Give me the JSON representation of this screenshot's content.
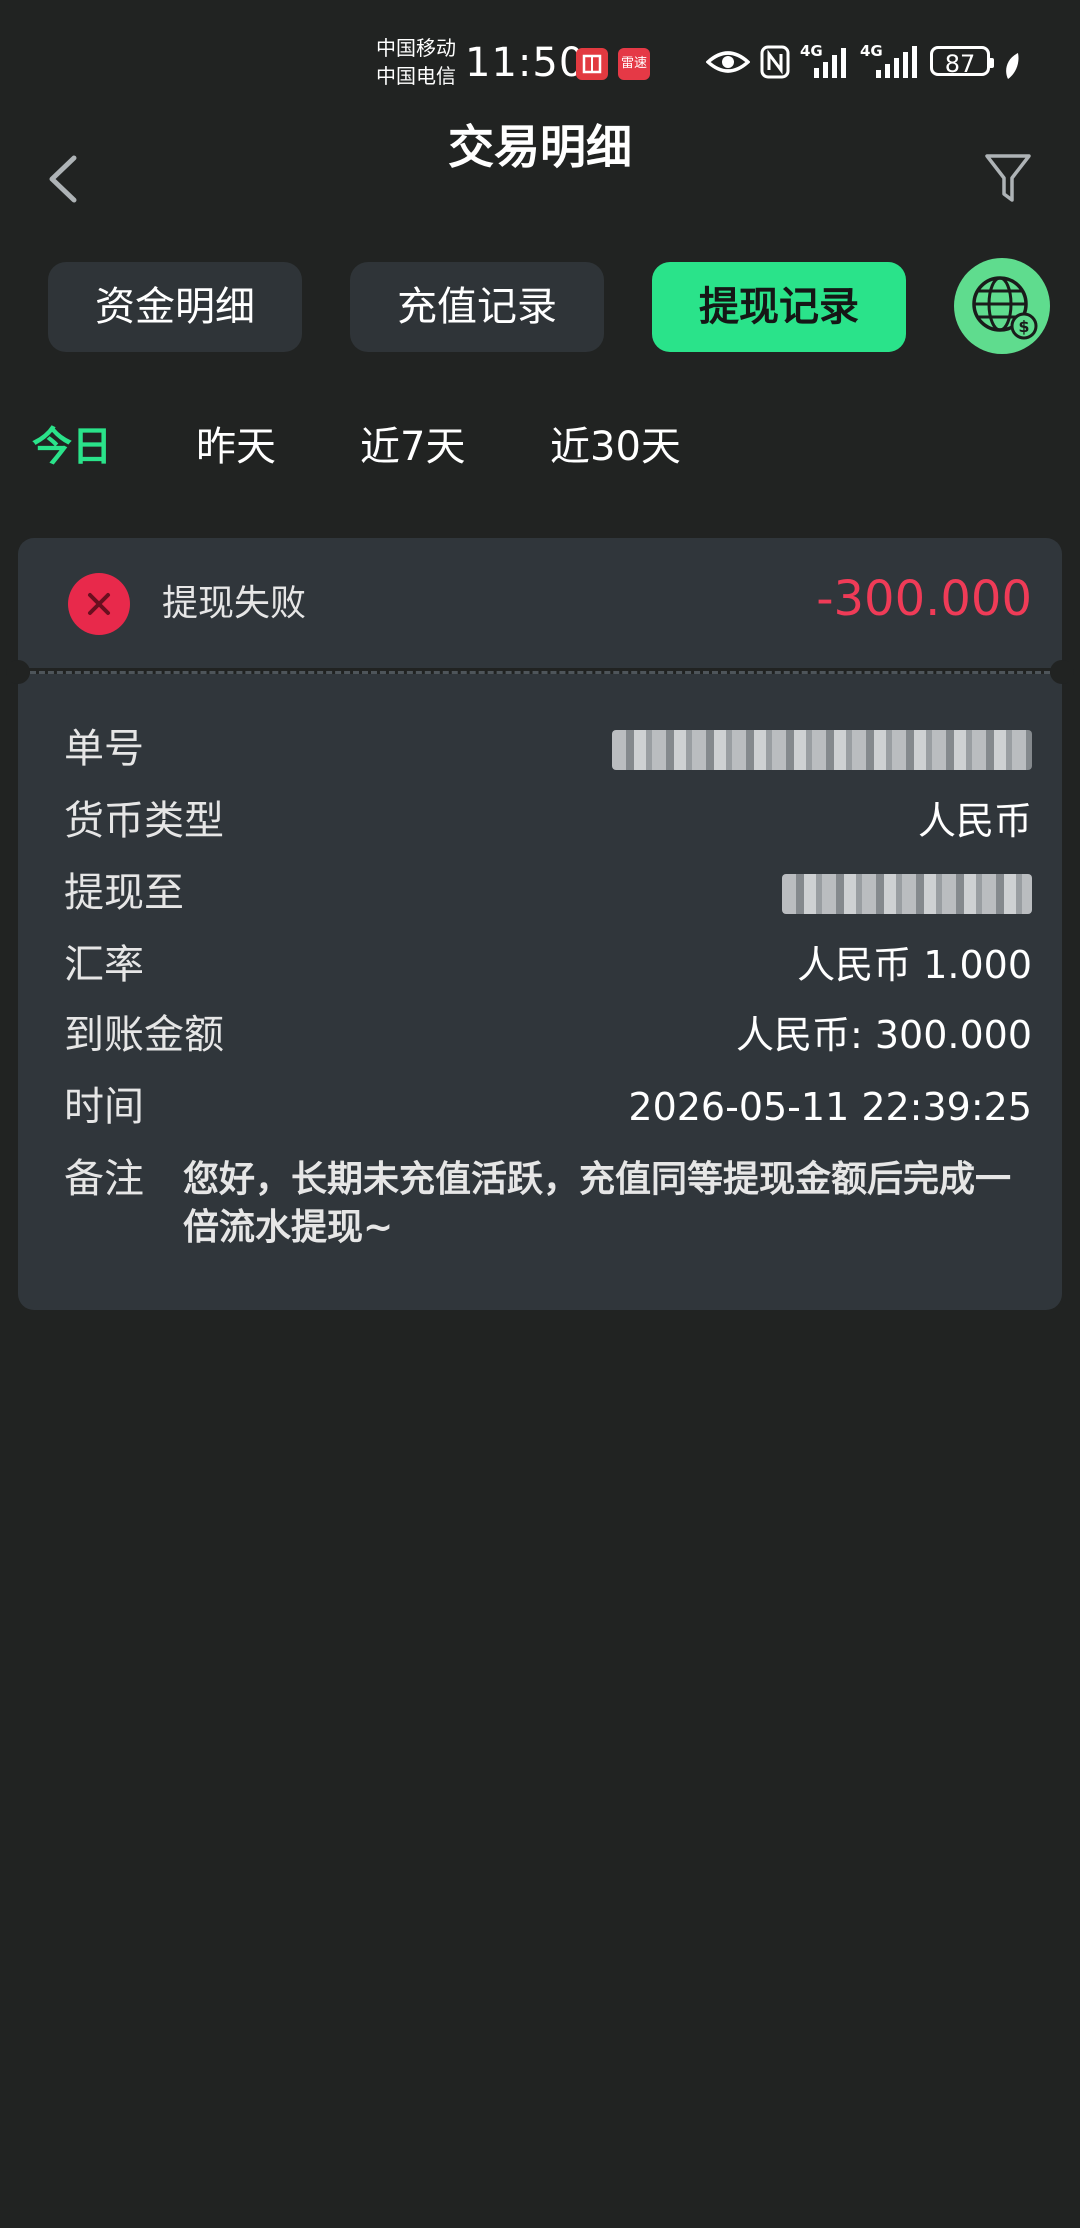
{
  "status_bar": {
    "carrier_1": "中国移动",
    "carrier_2": "中国电信",
    "time": "11:50",
    "network_1": "4G",
    "network_2": "4G",
    "battery": "87",
    "app_icon_2_text": "雷速"
  },
  "header": {
    "title": "交易明细"
  },
  "tabs": [
    {
      "label": "资金明细",
      "active": false
    },
    {
      "label": "充值记录",
      "active": false
    },
    {
      "label": "提现记录",
      "active": true
    }
  ],
  "date_filters": [
    {
      "label": "今日",
      "active": true
    },
    {
      "label": "昨天",
      "active": false
    },
    {
      "label": "近7天",
      "active": false
    },
    {
      "label": "近30天",
      "active": false
    }
  ],
  "record": {
    "status": "提现失败",
    "amount": "-300.000",
    "fields": {
      "order_no_label": "单号",
      "currency_label": "货币类型",
      "currency_value": "人民币",
      "withdraw_to_label": "提现至",
      "rate_label": "汇率",
      "rate_value": "人民币 1.000",
      "received_label": "到账金额",
      "received_value": "人民币: 300.000",
      "time_label": "时间",
      "time_value": "2026-05-11 22:39:25",
      "note_label": "备注",
      "note_value": "您好，长期未充值活跃，充值同等提现金额后完成一倍流水提现~"
    }
  },
  "colors": {
    "background": "#212322",
    "card": "#30363b",
    "accent_green": "#2ae38a",
    "error_red": "#e8294b",
    "amount_red": "#ef3b57"
  }
}
